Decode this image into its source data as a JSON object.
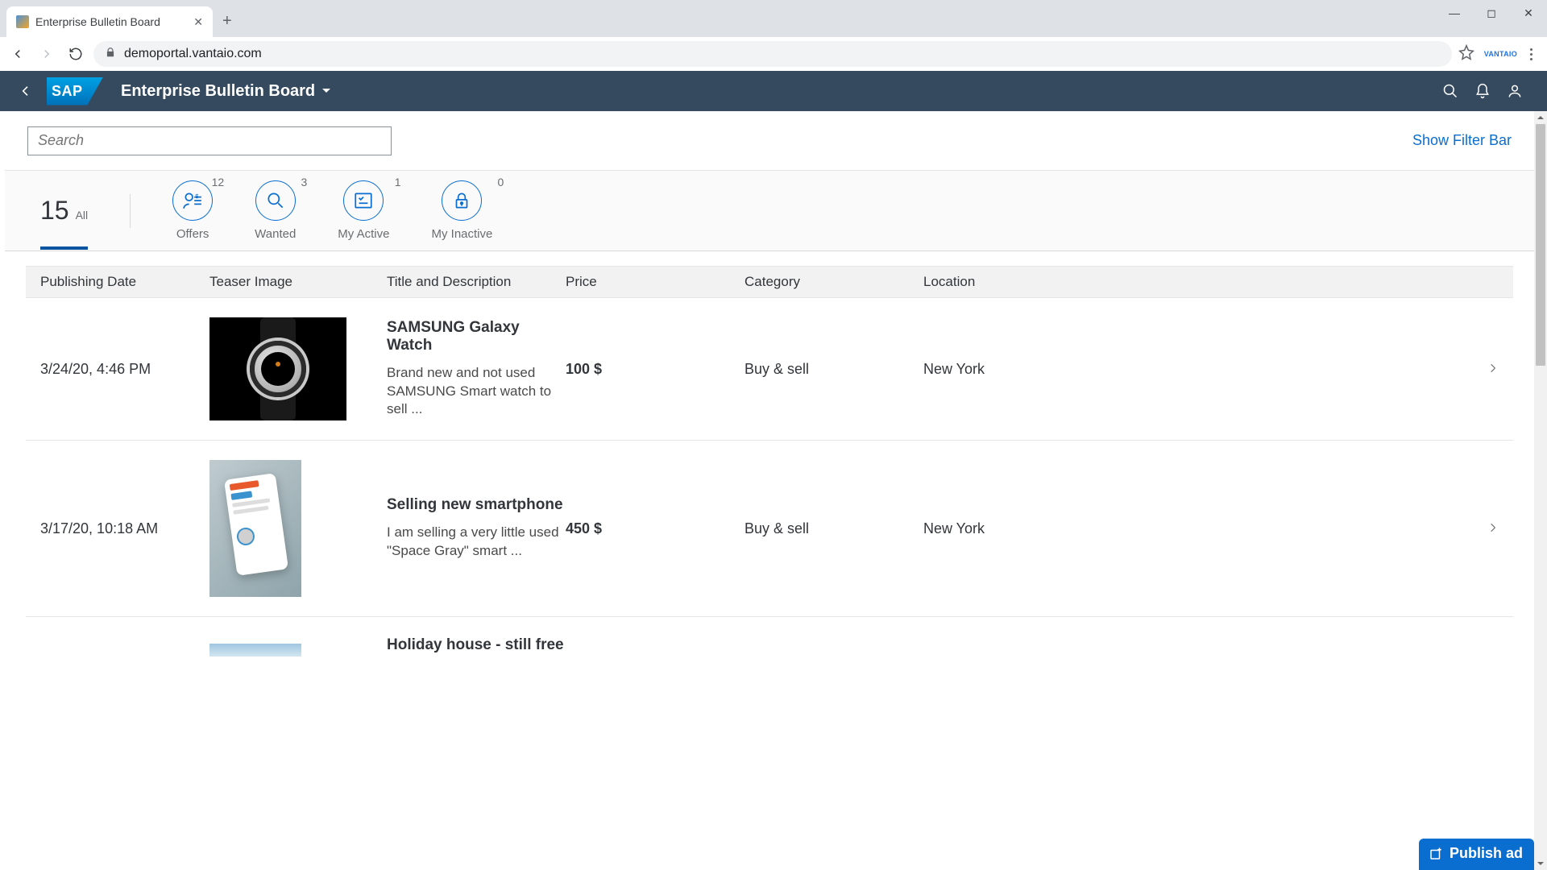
{
  "browser": {
    "tab_title": "Enterprise Bulletin Board",
    "url": "demoportal.vantaio.com",
    "ext_label": "VANTAIO"
  },
  "shell": {
    "title": "Enterprise Bulletin Board"
  },
  "filterbar": {
    "search_placeholder": "Search",
    "show_filter_link": "Show Filter Bar"
  },
  "icontabbar": {
    "all_count": "15",
    "all_label": "All",
    "filters": [
      {
        "count": "12",
        "label": "Offers"
      },
      {
        "count": "3",
        "label": "Wanted"
      },
      {
        "count": "1",
        "label": "My Active"
      },
      {
        "count": "0",
        "label": "My Inactive"
      }
    ]
  },
  "table": {
    "columns": {
      "date": "Publishing Date",
      "image": "Teaser Image",
      "title": "Title and Description",
      "price": "Price",
      "category": "Category",
      "location": "Location"
    },
    "rows": [
      {
        "date": "3/24/20, 4:46 PM",
        "title": "SAMSUNG Galaxy Watch",
        "desc": "Brand new and not used SAMSUNG Smart watch to sell ...",
        "price": "100 $",
        "category": "Buy & sell",
        "location": "New York"
      },
      {
        "date": "3/17/20, 10:18 AM",
        "title": "Selling new smartphone",
        "desc": "I am selling a very little used \"Space Gray\" smart ...",
        "price": "450 $",
        "category": "Buy & sell",
        "location": "New York"
      },
      {
        "date": "",
        "title": "Holiday house - still free",
        "desc": "",
        "price": "",
        "category": "",
        "location": ""
      }
    ]
  },
  "publish_label": "Publish ad"
}
